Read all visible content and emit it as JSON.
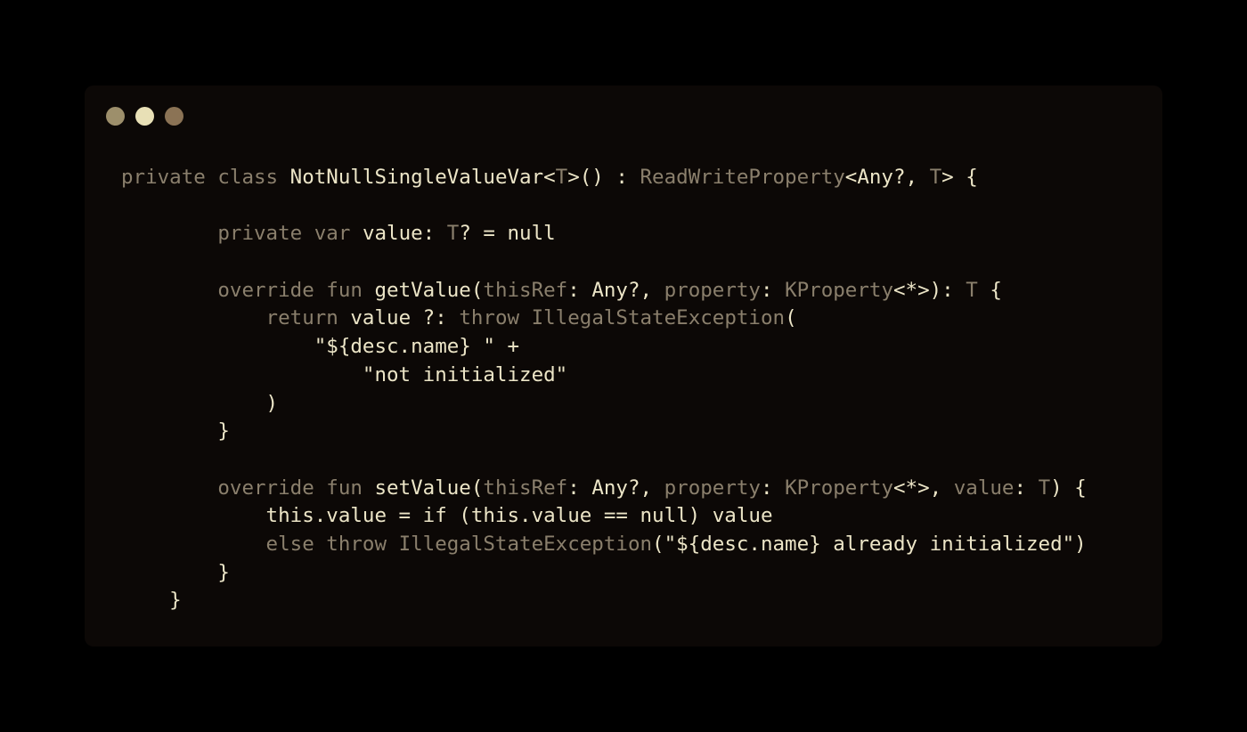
{
  "window": {
    "dots": [
      {
        "name": "close",
        "color": "#9d8f6b"
      },
      {
        "name": "minimize",
        "color": "#e8e0b6"
      },
      {
        "name": "maximize",
        "color": "#8b7355"
      }
    ]
  },
  "colors": {
    "background": "#000000",
    "window": "#0c0806",
    "keyword": "#8a7f6c",
    "text": "#ece5c7"
  },
  "code": {
    "lines": [
      [
        {
          "t": "kw",
          "v": "private class "
        },
        {
          "t": "name",
          "v": "NotNullSingleValueVar<"
        },
        {
          "t": "type",
          "v": "T"
        },
        {
          "t": "name",
          "v": ">() : "
        },
        {
          "t": "type",
          "v": "ReadWriteProperty"
        },
        {
          "t": "name",
          "v": "<Any?, "
        },
        {
          "t": "type",
          "v": "T"
        },
        {
          "t": "name",
          "v": "> {"
        }
      ],
      [],
      [
        {
          "t": "kw",
          "v": "        private var "
        },
        {
          "t": "name",
          "v": "value: "
        },
        {
          "t": "type",
          "v": "T"
        },
        {
          "t": "name",
          "v": "? = null"
        }
      ],
      [],
      [
        {
          "t": "kw",
          "v": "        override fun "
        },
        {
          "t": "name",
          "v": "getValue("
        },
        {
          "t": "param",
          "v": "thisRef"
        },
        {
          "t": "name",
          "v": ": Any?, "
        },
        {
          "t": "param",
          "v": "property"
        },
        {
          "t": "name",
          "v": ": "
        },
        {
          "t": "type",
          "v": "KProperty"
        },
        {
          "t": "name",
          "v": "<*>): "
        },
        {
          "t": "type",
          "v": "T"
        },
        {
          "t": "name",
          "v": " {"
        }
      ],
      [
        {
          "t": "kw",
          "v": "            return "
        },
        {
          "t": "name",
          "v": "value ?: "
        },
        {
          "t": "kw",
          "v": "throw "
        },
        {
          "t": "type",
          "v": "IllegalStateException"
        },
        {
          "t": "name",
          "v": "("
        }
      ],
      [
        {
          "t": "str",
          "v": "                \"${desc.name} \" +"
        }
      ],
      [
        {
          "t": "str",
          "v": "                    \"not initialized\""
        }
      ],
      [
        {
          "t": "punct",
          "v": "            )"
        }
      ],
      [
        {
          "t": "punct",
          "v": "        }"
        }
      ],
      [],
      [
        {
          "t": "kw",
          "v": "        override fun "
        },
        {
          "t": "name",
          "v": "setValue("
        },
        {
          "t": "param",
          "v": "thisRef"
        },
        {
          "t": "name",
          "v": ": Any?, "
        },
        {
          "t": "param",
          "v": "property"
        },
        {
          "t": "name",
          "v": ": "
        },
        {
          "t": "type",
          "v": "KProperty"
        },
        {
          "t": "name",
          "v": "<*>, "
        },
        {
          "t": "param",
          "v": "value"
        },
        {
          "t": "name",
          "v": ": "
        },
        {
          "t": "type",
          "v": "T"
        },
        {
          "t": "name",
          "v": ") {"
        }
      ],
      [
        {
          "t": "name",
          "v": "            this.value = if (this.value == null) value"
        }
      ],
      [
        {
          "t": "kw",
          "v": "            else throw "
        },
        {
          "t": "type",
          "v": "IllegalStateException"
        },
        {
          "t": "name",
          "v": "(\"${desc.name} already initialized\")"
        }
      ],
      [
        {
          "t": "punct",
          "v": "        }"
        }
      ],
      [
        {
          "t": "punct",
          "v": "    }"
        }
      ]
    ]
  }
}
